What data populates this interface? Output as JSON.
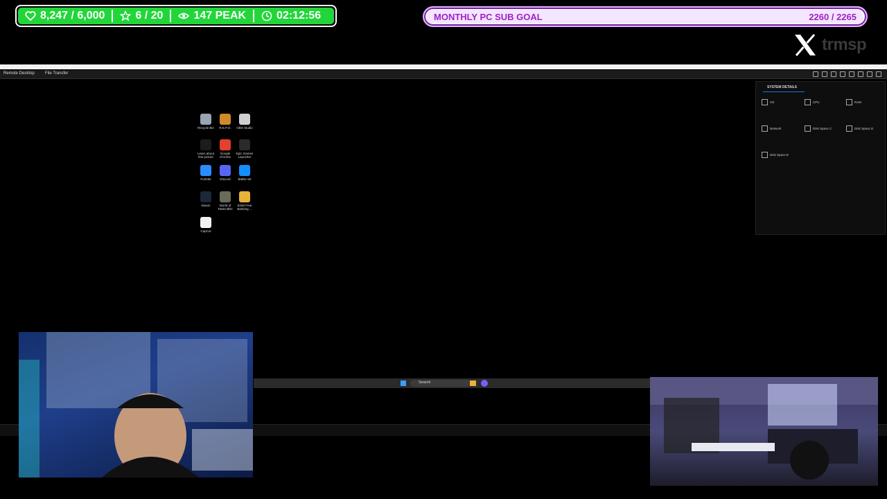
{
  "stats": {
    "followers": "8,247 / 6,000",
    "goal_stars": "6 / 20",
    "viewers": "147 PEAK",
    "uptime": "02:12:56",
    "accent": "#22d63a"
  },
  "sub_goal": {
    "label": "MONTHLY PC SUB GOAL",
    "value": "2260 / 2265",
    "progress": 0.998,
    "accent": "#a020c8"
  },
  "brand": {
    "name": "trmsp"
  },
  "remote_desktop": {
    "menu": [
      "Remote Desktop",
      "File Transfer"
    ],
    "desktop_icons": [
      {
        "label": "Recycle Bin",
        "icon": "recycle-bin-icon",
        "color": "#9aa4b2"
      },
      {
        "label": "R.E.P.O.",
        "icon": "game-icon",
        "color": "#d08a2a"
      },
      {
        "label": "OBS Studio",
        "icon": "obs-icon",
        "color": "#cfcfcf"
      },
      {
        "label": "Learn about this picture",
        "icon": "camera-icon",
        "color": "#1c1c1c"
      },
      {
        "label": "Google Chrome",
        "icon": "chrome-icon",
        "color": "#e3402d"
      },
      {
        "label": "Epic Games Launcher",
        "icon": "epic-icon",
        "color": "#2a2a2a"
      },
      {
        "label": "Fortnite",
        "icon": "fortnite-icon",
        "color": "#2a8cff"
      },
      {
        "label": "Discord",
        "icon": "discord-icon",
        "color": "#5865f2"
      },
      {
        "label": "Battle.net",
        "icon": "battlenet-icon",
        "color": "#148eff"
      },
      {
        "label": "Steam",
        "icon": "steam-icon",
        "color": "#1b2838"
      },
      {
        "label": "World of Tanks Blitz",
        "icon": "tank-icon",
        "color": "#6b6b5a"
      },
      {
        "label": "EOM Free Banking ...",
        "icon": "folder-icon",
        "color": "#e8b23a"
      },
      {
        "label": "CapCut",
        "icon": "capcut-icon",
        "color": "#f2f2f2"
      }
    ],
    "system_details": {
      "title": "SYSTEM DETAILS",
      "items": [
        {
          "title": "OS",
          "icon": "windows-icon"
        },
        {
          "title": "CPU",
          "icon": "cpu-icon"
        },
        {
          "title": "RAM",
          "icon": "ram-icon"
        },
        {
          "title": "Network",
          "icon": "network-icon"
        },
        {
          "title": "Disk Space C",
          "icon": "disk-icon"
        },
        {
          "title": "Disk Space D",
          "icon": "disk-icon"
        },
        {
          "title": "Disk Space E",
          "icon": "disk-icon"
        }
      ]
    },
    "taskbar": {
      "search_label": "Search"
    }
  }
}
